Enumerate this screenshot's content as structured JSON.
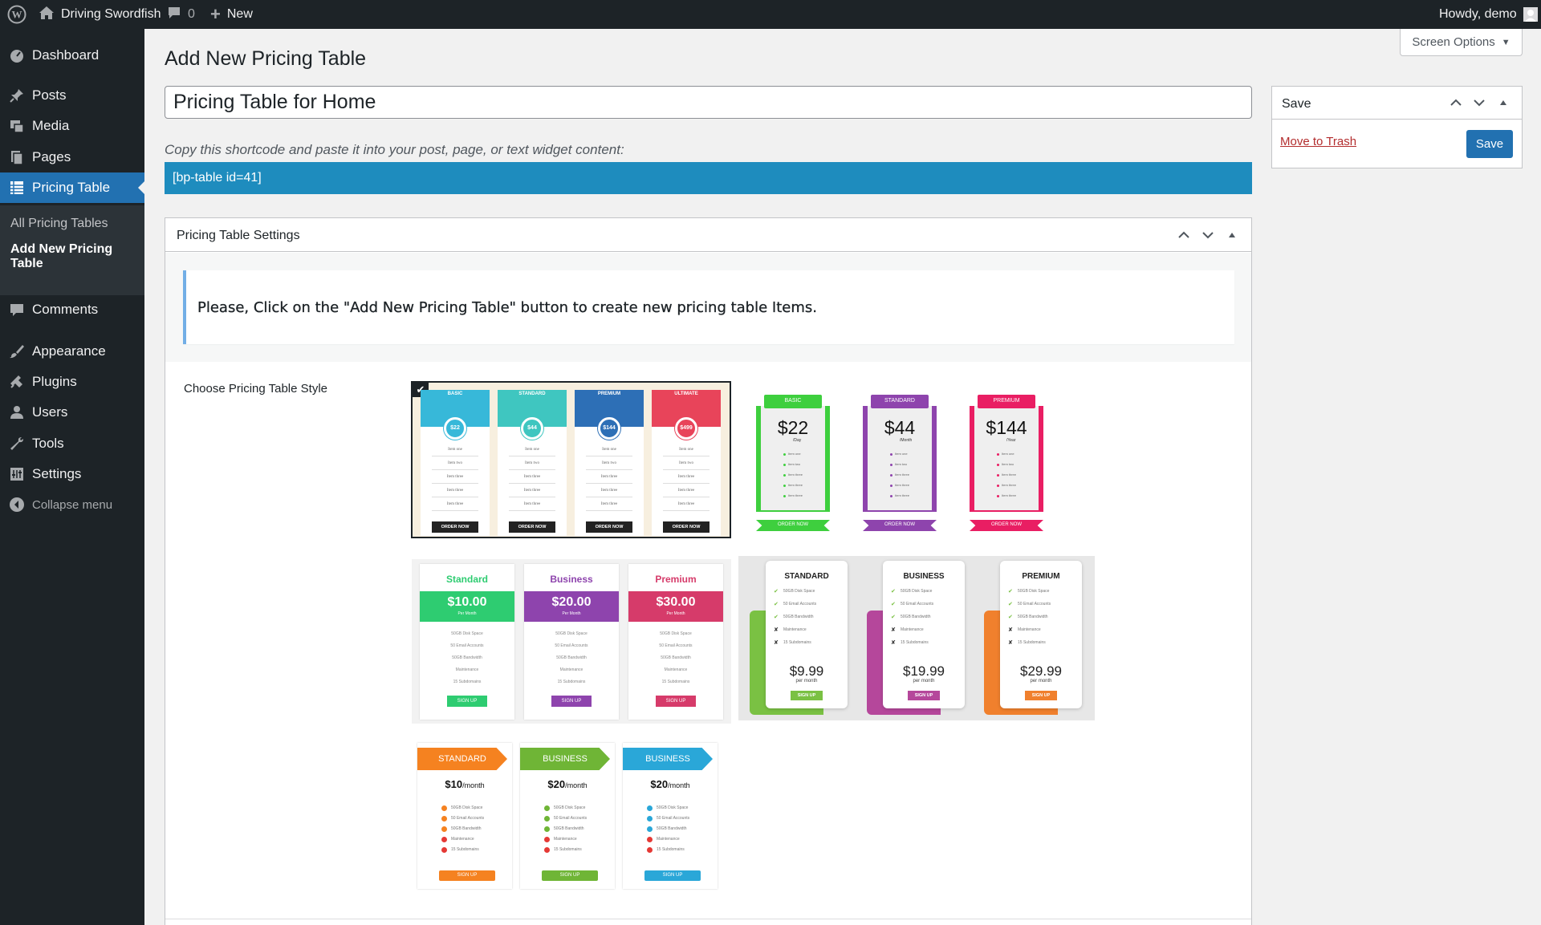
{
  "adminbar": {
    "site_name": "Driving Swordfish",
    "comments_count": "0",
    "new_label": "New",
    "howdy": "Howdy, demo"
  },
  "sidebar": {
    "items": [
      {
        "label": "Dashboard",
        "icon": "dashboard-icon"
      },
      {
        "label": "Posts",
        "icon": "pin-icon"
      },
      {
        "label": "Media",
        "icon": "media-icon"
      },
      {
        "label": "Pages",
        "icon": "pages-icon"
      },
      {
        "label": "Pricing Table",
        "icon": "table-icon"
      },
      {
        "label": "Comments",
        "icon": "comment-icon"
      },
      {
        "label": "Appearance",
        "icon": "brush-icon"
      },
      {
        "label": "Plugins",
        "icon": "plugin-icon"
      },
      {
        "label": "Users",
        "icon": "user-icon"
      },
      {
        "label": "Tools",
        "icon": "wrench-icon"
      },
      {
        "label": "Settings",
        "icon": "settings-icon"
      },
      {
        "label": "Collapse menu",
        "icon": "collapse-icon"
      }
    ],
    "submenu": [
      "All Pricing Tables",
      "Add New Pricing Table"
    ]
  },
  "screen_options": "Screen Options",
  "page_title": "Add New Pricing Table",
  "title_input_value": "Pricing Table for Home",
  "shortcode_hint": "Copy this shortcode and paste it into your post, page, or text widget content:",
  "shortcode": "[bp-table id=41]",
  "settings_box": {
    "title": "Pricing Table Settings",
    "notice": "Please, Click on the \"Add New Pricing Table\" button to create new pricing table Items.",
    "style_label": "Choose Pricing Table Style"
  },
  "save_box": {
    "title": "Save",
    "trash_label": "Move to Trash",
    "save_label": "Save"
  },
  "styles": {
    "style1": {
      "plans": [
        {
          "name": "BASIC",
          "price": "$22",
          "color": "#37b8d9",
          "features": [
            "Item one",
            "Item two",
            "Item three",
            "Item three",
            "Item three"
          ],
          "button": "ORDER NOW"
        },
        {
          "name": "STANDARD",
          "price": "$44",
          "color": "#3fc6c0",
          "features": [
            "Item one",
            "Item two",
            "Item three",
            "Item three",
            "Item three"
          ],
          "button": "ORDER NOW"
        },
        {
          "name": "PREMIUM",
          "price": "$144",
          "color": "#2d6fb6",
          "features": [
            "Item one",
            "Item two",
            "Item three",
            "Item three",
            "Item three"
          ],
          "button": "ORDER NOW"
        },
        {
          "name": "ULTIMATE",
          "price": "$499",
          "color": "#e8445a",
          "features": [
            "Item one",
            "Item two",
            "Item three",
            "Item three",
            "Item three"
          ],
          "button": "ORDER NOW"
        }
      ]
    },
    "style2": {
      "plans": [
        {
          "name": "BASIC",
          "price": "$22",
          "period": "/Day",
          "color": "#3ecf3e",
          "button": "ORDER NOW"
        },
        {
          "name": "STANDARD",
          "price": "$44",
          "period": "/Month",
          "color": "#8e44ad",
          "button": "ORDER NOW"
        },
        {
          "name": "PREMIUM",
          "price": "$144",
          "period": "/Year",
          "color": "#e91e63",
          "button": "ORDER NOW"
        }
      ],
      "features": [
        "Item one",
        "Item two",
        "Item three",
        "Item three",
        "Item three"
      ]
    },
    "style3": {
      "plans": [
        {
          "name": "Standard",
          "price": "$10.00",
          "period": "Per Month",
          "color": "#2ecc71",
          "button": "SIGN UP"
        },
        {
          "name": "Business",
          "price": "$20.00",
          "period": "Per Month",
          "color": "#8e44ad",
          "button": "SIGN UP"
        },
        {
          "name": "Premium",
          "price": "$30.00",
          "period": "Per Month",
          "color": "#d63b6a",
          "button": "SIGN UP"
        }
      ],
      "features": [
        "50GB Disk Space",
        "50 Email Accounts",
        "50GB Bandwidth",
        "Maintenance",
        "15 Subdomains"
      ]
    },
    "style4": {
      "plans": [
        {
          "name": "STANDARD",
          "price": "$9.99",
          "period": "per month",
          "color": "#7ac143",
          "button": "SIGN UP"
        },
        {
          "name": "BUSINESS",
          "price": "$19.99",
          "period": "per month",
          "color": "#b5479b",
          "button": "SIGN UP"
        },
        {
          "name": "PREMIUM",
          "price": "$29.99",
          "period": "per month",
          "color": "#f0802d",
          "button": "SIGN UP"
        }
      ],
      "features": [
        "50GB Disk Space",
        "50 Email Accounts",
        "50GB Bandwidth",
        "Maintenance",
        "15 Subdomains"
      ]
    },
    "style5": {
      "plans": [
        {
          "name": "STANDARD",
          "price": "$10",
          "period": "/month",
          "color": "#f58220",
          "button": "SIGN UP"
        },
        {
          "name": "BUSINESS",
          "price": "$20",
          "period": "/month",
          "color": "#6fb536",
          "button": "SIGN UP"
        },
        {
          "name": "BUSINESS",
          "price": "$20",
          "period": "/month",
          "color": "#2aa7d8",
          "button": "SIGN UP"
        }
      ],
      "features": [
        "50GB Disk Space",
        "50 Email Accounts",
        "50GB Bandwidth",
        "Maintenance",
        "15 Subdomains"
      ]
    }
  }
}
